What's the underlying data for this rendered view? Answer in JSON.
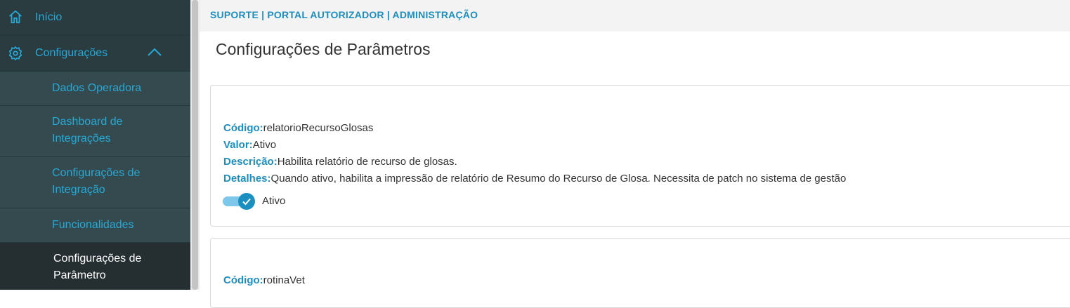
{
  "sidebar": {
    "home_label": "Início",
    "config_label": "Configurações",
    "items": [
      {
        "label": "Dados Operadora"
      },
      {
        "label": "Dashboard de Integrações"
      },
      {
        "label": "Configurações de Integração"
      },
      {
        "label": "Funcionalidades"
      },
      {
        "label": "Configurações de Parâmetro"
      }
    ]
  },
  "header": {
    "breadcrumb": "SUPORTE | PORTAL AUTORIZADOR | ADMINISTRAÇÃO"
  },
  "main": {
    "title": "Configurações de Parâmetros",
    "labels": {
      "codigo": "Código:",
      "valor": "Valor:",
      "descricao": "Descrição:",
      "detalhes": "Detalhes:"
    },
    "params": [
      {
        "codigo": "relatorioRecursoGlosas",
        "valor": "Ativo",
        "descricao": "Habilita relatório de recurso de glosas.",
        "detalhes": "Quando ativo, habilita a impressão de relatório de Resumo do Recurso de Glosa. Necessita de patch no sistema de gestão",
        "toggle_on": true,
        "toggle_label": "Ativo"
      },
      {
        "codigo": "rotinaVet"
      }
    ]
  },
  "colors": {
    "accent": "#1c8fbf",
    "sidebar_bg": "#344a4f",
    "sidebar_active": "#252f31",
    "topbar_bg": "#f3f3f3"
  },
  "icons": {
    "home": "home-icon",
    "settings": "gear-icon",
    "chevron": "chevron-up-icon",
    "check": "check-icon"
  }
}
